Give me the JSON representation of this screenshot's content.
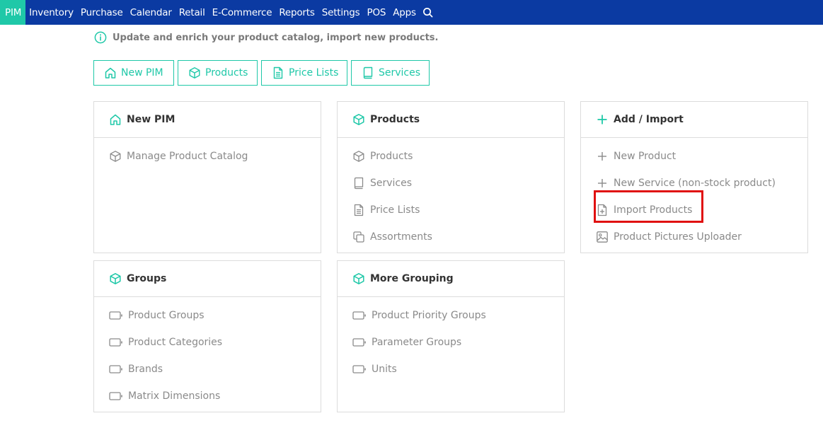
{
  "nav": {
    "items": [
      "PIM",
      "Inventory",
      "Purchase",
      "Calendar",
      "Retail",
      "E-Commerce",
      "Reports",
      "Settings",
      "POS",
      "Apps"
    ],
    "active_index": 0,
    "search_icon": "search-icon"
  },
  "info": {
    "text": "Update and enrich your product catalog, import new products.",
    "icon": "info-icon"
  },
  "quick_buttons": [
    {
      "label": "New PIM",
      "icon": "home-icon"
    },
    {
      "label": "Products",
      "icon": "box-icon"
    },
    {
      "label": "Price Lists",
      "icon": "document-icon"
    },
    {
      "label": "Services",
      "icon": "book-icon"
    }
  ],
  "cards": {
    "new_pim": {
      "title": "New PIM",
      "icon": "home-icon",
      "links": [
        {
          "label": "Manage Product Catalog",
          "icon": "box-icon"
        }
      ]
    },
    "products": {
      "title": "Products",
      "icon": "box-icon",
      "links": [
        {
          "label": "Products",
          "icon": "box-icon"
        },
        {
          "label": "Services",
          "icon": "book-icon"
        },
        {
          "label": "Price Lists",
          "icon": "document-icon"
        },
        {
          "label": "Assortments",
          "icon": "copy-icon"
        }
      ]
    },
    "add_import": {
      "title": "Add / Import",
      "icon": "plus-icon",
      "links": [
        {
          "label": "New Product",
          "icon": "plus-icon"
        },
        {
          "label": "New Service (non-stock product)",
          "icon": "plus-icon"
        },
        {
          "label": "Import Products",
          "icon": "file-plus-icon"
        },
        {
          "label": "Product Pictures Uploader",
          "icon": "image-icon"
        }
      ]
    },
    "groups": {
      "title": "Groups",
      "icon": "box-icon",
      "links": [
        {
          "label": "Product Groups",
          "icon": "folder-tag-icon"
        },
        {
          "label": "Product Categories",
          "icon": "folder-tag-icon"
        },
        {
          "label": "Brands",
          "icon": "folder-tag-icon"
        },
        {
          "label": "Matrix Dimensions",
          "icon": "folder-tag-icon"
        }
      ]
    },
    "more_grouping": {
      "title": "More Grouping",
      "icon": "box-icon",
      "links": [
        {
          "label": "Product Priority Groups",
          "icon": "folder-tag-icon"
        },
        {
          "label": "Parameter Groups",
          "icon": "folder-tag-icon"
        },
        {
          "label": "Units",
          "icon": "folder-tag-icon"
        }
      ]
    }
  },
  "colors": {
    "nav_bg": "#0b3aa2",
    "accent": "#1fc8a8",
    "highlight": "#e01010"
  }
}
